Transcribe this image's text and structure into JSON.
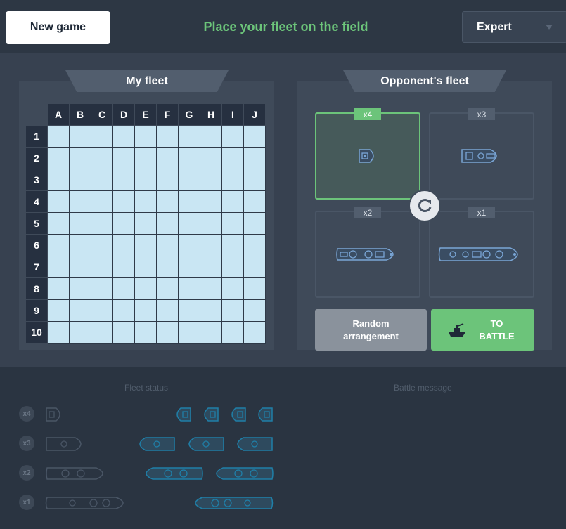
{
  "header": {
    "new_game_label": "New game",
    "status_message": "Place your fleet on the field",
    "difficulty_selected": "Expert"
  },
  "my_fleet": {
    "title": "My fleet",
    "columns": [
      "A",
      "B",
      "C",
      "D",
      "E",
      "F",
      "G",
      "H",
      "I",
      "J"
    ],
    "rows": [
      "1",
      "2",
      "3",
      "4",
      "5",
      "6",
      "7",
      "8",
      "9",
      "10"
    ]
  },
  "opponent_fleet": {
    "title": "Opponent's fleet",
    "slots": [
      {
        "count": "x4",
        "size": 1,
        "active": true
      },
      {
        "count": "x3",
        "size": 2,
        "active": false
      },
      {
        "count": "x2",
        "size": 3,
        "active": false
      },
      {
        "count": "x1",
        "size": 4,
        "active": false
      }
    ],
    "random_label_line1": "Random",
    "random_label_line2": "arrangement",
    "battle_label_line1": "TO",
    "battle_label_line2": "BATTLE"
  },
  "bottom": {
    "fleet_status_title": "Fleet status",
    "battle_message_title": "Battle message",
    "fleet_status": [
      {
        "count": "x4",
        "size": 1,
        "remaining": 4
      },
      {
        "count": "x3",
        "size": 2,
        "remaining": 3
      },
      {
        "count": "x2",
        "size": 3,
        "remaining": 2
      },
      {
        "count": "x1",
        "size": 4,
        "remaining": 1
      }
    ]
  },
  "colors": {
    "accent_green": "#6cc47a",
    "cell_water": "#c9e6f3",
    "ship_blue": "#7aa6d6",
    "ship_cyan": "#1f7fa8"
  }
}
